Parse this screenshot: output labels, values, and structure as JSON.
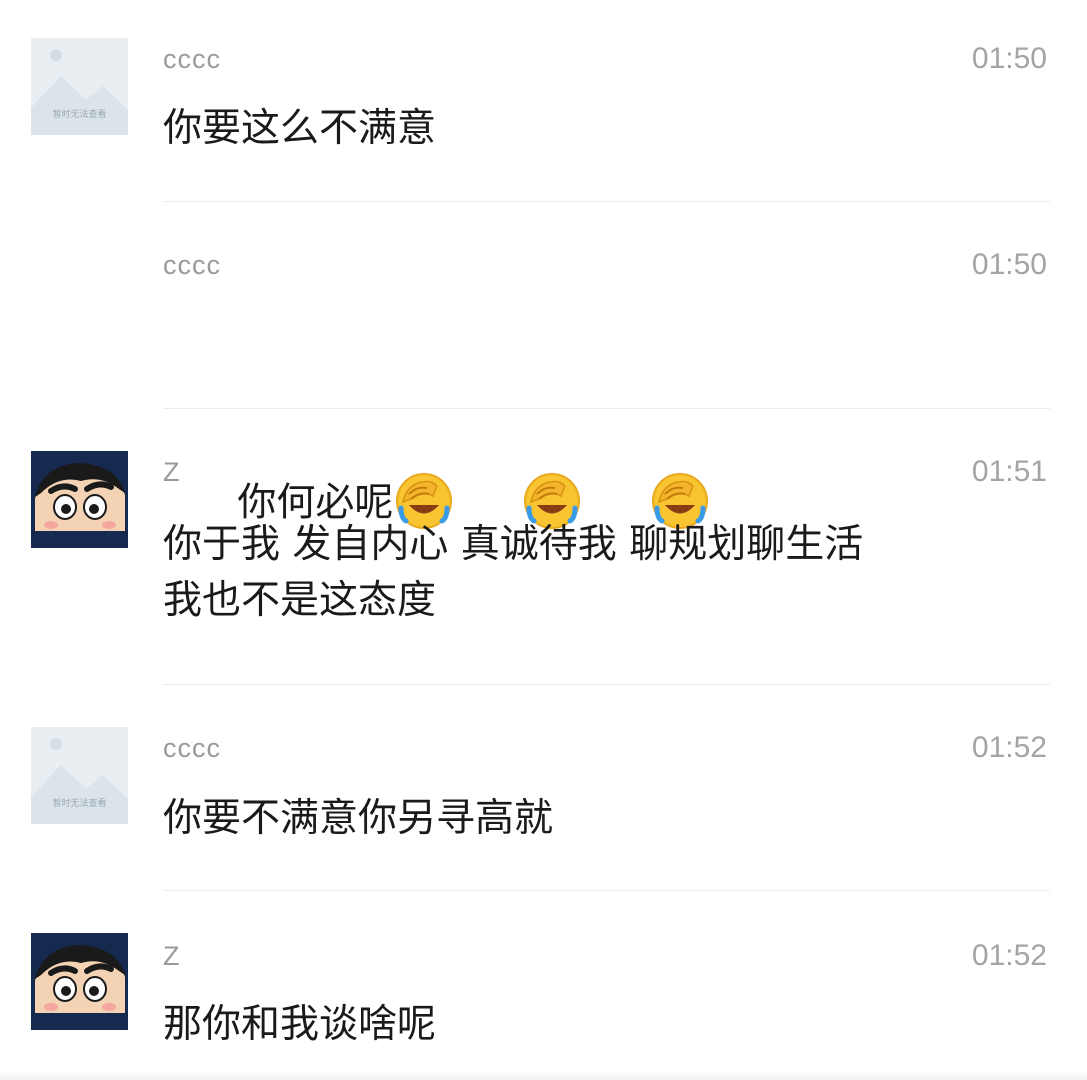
{
  "placeholder_avatar_text": "暂时无法查看",
  "emoji_name": "face-palm-crying-emoji",
  "colors": {
    "sender": "#9a9a9a",
    "time": "#a4a4a4",
    "text": "#1a1a1a",
    "divider": "#ececec",
    "shin_bg": "#16294e"
  },
  "messages": [
    {
      "sender": "cccc",
      "time": "01:50",
      "text": "你要这么不满意",
      "avatar": "placeholder-image"
    },
    {
      "sender": "cccc",
      "time": "01:50",
      "text": "你何必呢",
      "emoji_count": 3
    },
    {
      "sender": "Z",
      "time": "01:51",
      "text": "你于我 发自内心 真诚待我 聊规划聊生活\n我也不是这态度",
      "avatar": "crayon-shin-chan"
    },
    {
      "sender": "cccc",
      "time": "01:52",
      "text": "你要不满意你另寻高就",
      "avatar": "placeholder-image"
    },
    {
      "sender": "Z",
      "time": "01:52",
      "text": "那你和我谈啥呢",
      "avatar": "crayon-shin-chan"
    }
  ]
}
